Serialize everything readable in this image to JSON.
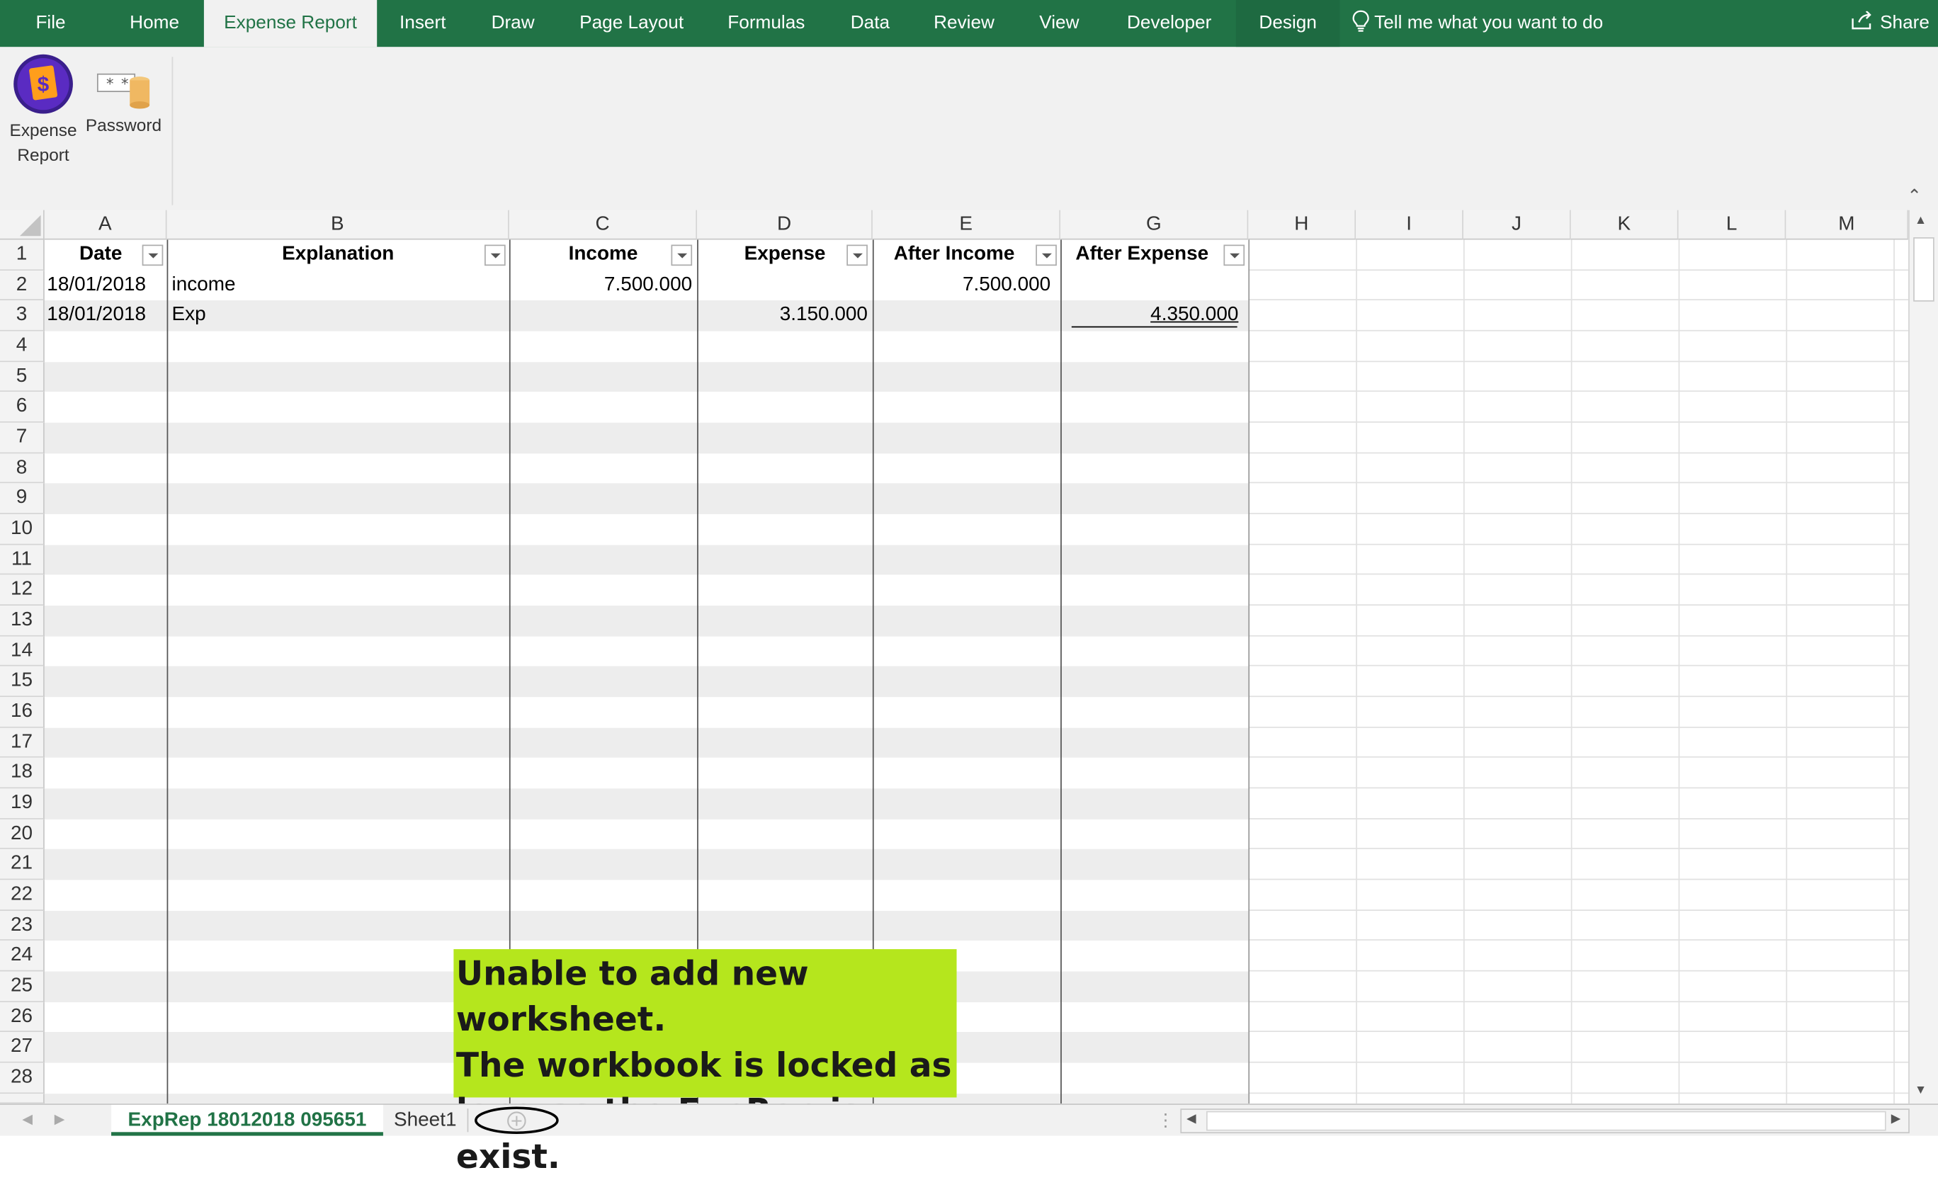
{
  "ribbon": {
    "tabs": [
      {
        "label": "File"
      },
      {
        "label": "Home"
      },
      {
        "label": "Expense Report",
        "active": true
      },
      {
        "label": "Insert"
      },
      {
        "label": "Draw"
      },
      {
        "label": "Page Layout"
      },
      {
        "label": "Formulas"
      },
      {
        "label": "Data"
      },
      {
        "label": "Review"
      },
      {
        "label": "View"
      },
      {
        "label": "Developer"
      },
      {
        "label": "Design"
      }
    ],
    "tell_me": "Tell me what you want to do",
    "share": "Share",
    "buttons": {
      "expense_report": "Expense\nReport",
      "password": "Password"
    },
    "accent": "#217346"
  },
  "sheet": {
    "columns": [
      "A",
      "B",
      "C",
      "D",
      "E",
      "G",
      "H",
      "I",
      "J",
      "K",
      "L",
      "M"
    ],
    "rows": [
      "1",
      "2",
      "3",
      "4",
      "5",
      "6",
      "7",
      "8",
      "9",
      "10",
      "11",
      "12",
      "13",
      "14",
      "15",
      "16",
      "17",
      "18",
      "19",
      "20",
      "21",
      "22",
      "23",
      "24",
      "25",
      "26",
      "27",
      "28"
    ],
    "table_headers": [
      "Date",
      "Explanation",
      "Income",
      "Expense",
      "After Income",
      "After Expense"
    ],
    "table_rows": [
      {
        "date": "18/01/2018",
        "explanation": "income",
        "income": "7.500.000",
        "expense": "",
        "after_income": "7.500.000",
        "after_expense": ""
      },
      {
        "date": "18/01/2018",
        "explanation": "Exp",
        "income": "",
        "expense": "3.150.000",
        "after_income": "",
        "after_expense": "4.350.000"
      }
    ]
  },
  "annotation": {
    "text": "Unable to add new worksheet.\nThe workbook is locked as\nlong as the ExpRep is exist.",
    "background": "#b5e61d"
  },
  "sheet_tabs": {
    "active": "ExpRep 18012018 095651",
    "other": "Sheet1"
  }
}
